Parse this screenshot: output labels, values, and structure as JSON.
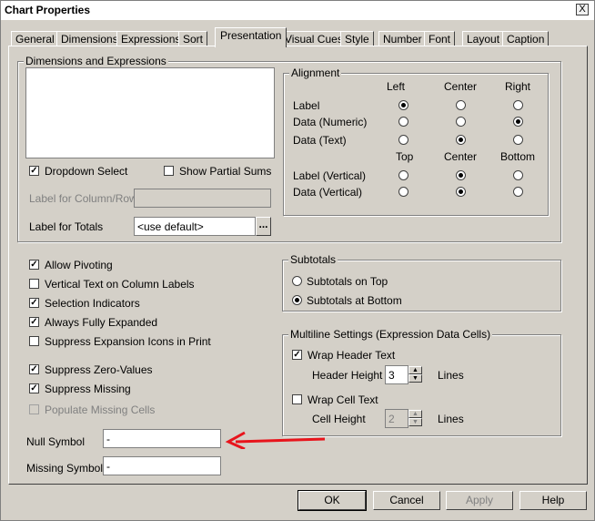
{
  "window": {
    "title": "Chart Properties",
    "close_glyph": "X"
  },
  "tabs": [
    "General",
    "Dimensions",
    "Expressions",
    "Sort",
    "Presentation",
    "Visual Cues",
    "Style",
    "Number",
    "Font",
    "Layout",
    "Caption"
  ],
  "active_tab": "Presentation",
  "dimensions_expressions": {
    "legend": "Dimensions and Expressions",
    "dropdown_select": "Dropdown Select",
    "show_partial_sums": "Show Partial Sums",
    "label_for_column_row": "Label for Column/Row",
    "label_for_totals": "Label for Totals",
    "totals_value": "<use default>",
    "browse_label": "..."
  },
  "alignment": {
    "legend": "Alignment",
    "col_left": "Left",
    "col_center": "Center",
    "col_right": "Right",
    "label": "Label",
    "data_numeric": "Data (Numeric)",
    "data_text": "Data (Text)",
    "col_top": "Top",
    "col_center_v": "Center",
    "col_bottom": "Bottom",
    "label_vertical": "Label (Vertical)",
    "data_vertical": "Data (Vertical)"
  },
  "options": {
    "allow_pivoting": "Allow Pivoting",
    "vertical_text": "Vertical Text on Column Labels",
    "selection_indicators": "Selection Indicators",
    "always_fully_expanded": "Always Fully Expanded",
    "suppress_expansion_icons": "Suppress Expansion Icons in Print",
    "suppress_zero": "Suppress Zero-Values",
    "suppress_missing": "Suppress Missing",
    "populate_missing": "Populate Missing Cells"
  },
  "null_symbol": {
    "label": "Null Symbol",
    "value": "-"
  },
  "missing_symbol": {
    "label": "Missing Symbol",
    "value": "-"
  },
  "subtotals": {
    "legend": "Subtotals",
    "on_top": "Subtotals on Top",
    "at_bottom": "Subtotals at Bottom"
  },
  "multiline": {
    "legend": "Multiline Settings (Expression Data Cells)",
    "wrap_header": "Wrap Header Text",
    "header_height": "Header Height",
    "header_height_value": "3",
    "lines_1": "Lines",
    "wrap_cell": "Wrap Cell Text",
    "cell_height": "Cell Height",
    "cell_height_value": "2",
    "lines_2": "Lines"
  },
  "buttons": {
    "ok": "OK",
    "cancel": "Cancel",
    "apply": "Apply",
    "help": "Help"
  },
  "colors": {
    "annotation_arrow": "#e8141c"
  }
}
